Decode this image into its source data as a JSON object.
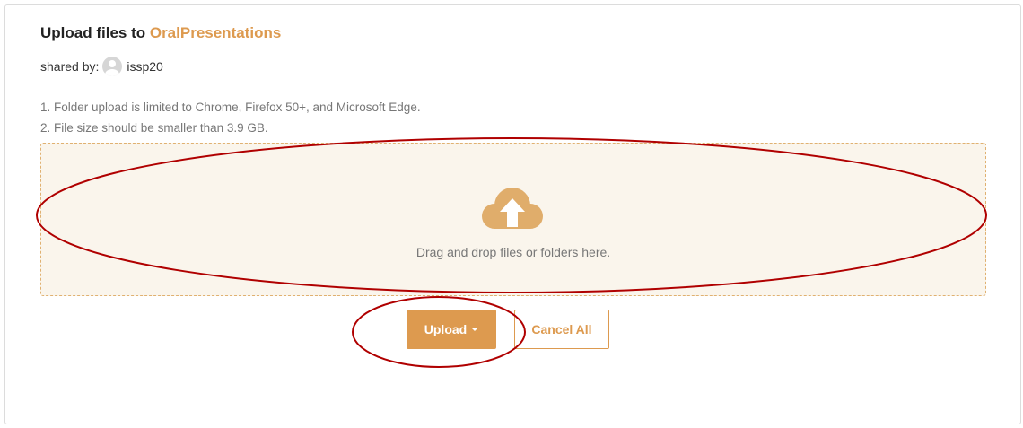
{
  "header": {
    "title_prefix": "Upload files to ",
    "folder_name": "OralPresentations"
  },
  "shared": {
    "label": "shared by:",
    "user": "issp20"
  },
  "notes": [
    "1. Folder upload is limited to Chrome, Firefox 50+, and Microsoft Edge.",
    "2. File size should be smaller than 3.9 GB."
  ],
  "dropzone": {
    "icon": "cloud-upload-icon",
    "text": "Drag and drop files or folders here."
  },
  "buttons": {
    "upload_label": "Upload",
    "cancel_label": "Cancel All"
  },
  "colors": {
    "accent": "#dd9a4f",
    "dropzone_bg": "#faf5ec",
    "annotation": "#b00000"
  }
}
